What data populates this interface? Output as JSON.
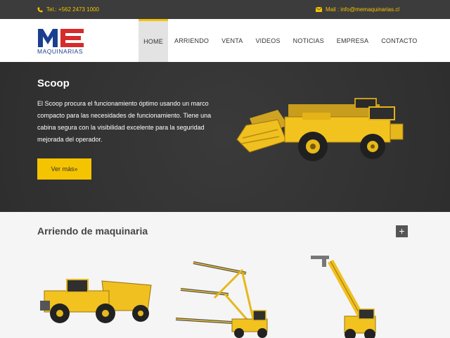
{
  "topbar": {
    "phone": "Tel.: +562 2473 1000",
    "phone_icon": "phone-icon",
    "mail": "Mail : info@memaquinarias.cl",
    "mail_icon": "envelope-icon"
  },
  "logo": {
    "mark": "ME",
    "text": "MAQUINARIAS"
  },
  "nav": [
    "HOME",
    "ARRIENDO",
    "VENTA",
    "VIDEOS",
    "NOTICIAS",
    "EMPRESA",
    "CONTACTO"
  ],
  "hero": {
    "title": "Scoop",
    "text": "El Scoop procura el funcionamiento óptimo usando un marco compacto para las necesidades de funcionamiento. Tiene una cabina segura con la visibilidad excelente para la seguridad mejorada del operador.",
    "button": "Ver más»"
  },
  "section": {
    "title": "Arriendo de maquinaria",
    "plus": "+"
  },
  "colors": {
    "accent": "#f5c400",
    "topbar": "#3c3c3c",
    "hero": "#333333",
    "brand_red": "#d62b2b",
    "brand_blue": "#1b3f8f"
  }
}
